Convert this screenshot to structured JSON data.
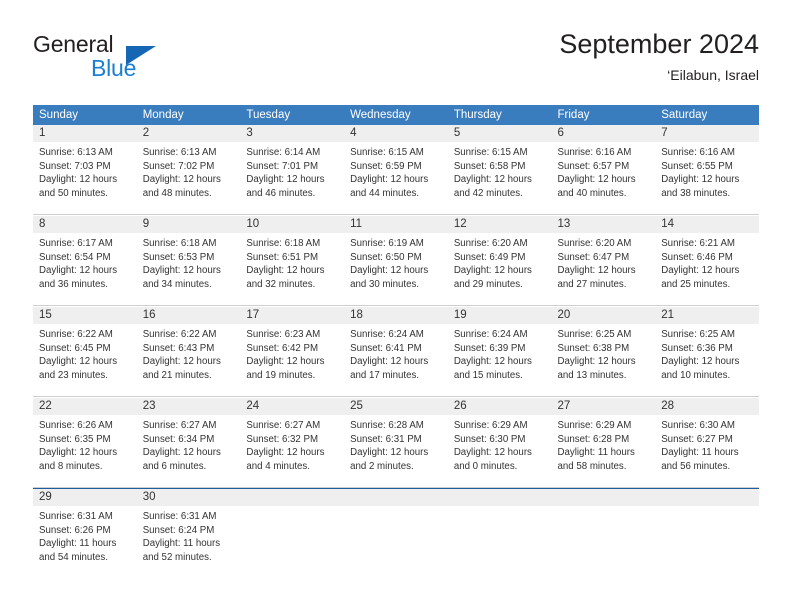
{
  "brand": {
    "name_part1": "General",
    "name_part2": "Blue",
    "triangle_color": "#1567b3",
    "blue_text_color": "#1a7fd4"
  },
  "header": {
    "title": "September 2024",
    "subtitle": "‘Eilabun, Israel"
  },
  "theme": {
    "header_bar_color": "#3a7dbf",
    "day_band_color": "#efefef",
    "cell_border_color": "#cfcfcf",
    "last_row_border_color": "#1f5fa0"
  },
  "weekdays": [
    "Sunday",
    "Monday",
    "Tuesday",
    "Wednesday",
    "Thursday",
    "Friday",
    "Saturday"
  ],
  "weeks": [
    [
      {
        "day": "1",
        "sunrise": "Sunrise: 6:13 AM",
        "sunset": "Sunset: 7:03 PM",
        "daylight": "Daylight: 12 hours and 50 minutes."
      },
      {
        "day": "2",
        "sunrise": "Sunrise: 6:13 AM",
        "sunset": "Sunset: 7:02 PM",
        "daylight": "Daylight: 12 hours and 48 minutes."
      },
      {
        "day": "3",
        "sunrise": "Sunrise: 6:14 AM",
        "sunset": "Sunset: 7:01 PM",
        "daylight": "Daylight: 12 hours and 46 minutes."
      },
      {
        "day": "4",
        "sunrise": "Sunrise: 6:15 AM",
        "sunset": "Sunset: 6:59 PM",
        "daylight": "Daylight: 12 hours and 44 minutes."
      },
      {
        "day": "5",
        "sunrise": "Sunrise: 6:15 AM",
        "sunset": "Sunset: 6:58 PM",
        "daylight": "Daylight: 12 hours and 42 minutes."
      },
      {
        "day": "6",
        "sunrise": "Sunrise: 6:16 AM",
        "sunset": "Sunset: 6:57 PM",
        "daylight": "Daylight: 12 hours and 40 minutes."
      },
      {
        "day": "7",
        "sunrise": "Sunrise: 6:16 AM",
        "sunset": "Sunset: 6:55 PM",
        "daylight": "Daylight: 12 hours and 38 minutes."
      }
    ],
    [
      {
        "day": "8",
        "sunrise": "Sunrise: 6:17 AM",
        "sunset": "Sunset: 6:54 PM",
        "daylight": "Daylight: 12 hours and 36 minutes."
      },
      {
        "day": "9",
        "sunrise": "Sunrise: 6:18 AM",
        "sunset": "Sunset: 6:53 PM",
        "daylight": "Daylight: 12 hours and 34 minutes."
      },
      {
        "day": "10",
        "sunrise": "Sunrise: 6:18 AM",
        "sunset": "Sunset: 6:51 PM",
        "daylight": "Daylight: 12 hours and 32 minutes."
      },
      {
        "day": "11",
        "sunrise": "Sunrise: 6:19 AM",
        "sunset": "Sunset: 6:50 PM",
        "daylight": "Daylight: 12 hours and 30 minutes."
      },
      {
        "day": "12",
        "sunrise": "Sunrise: 6:20 AM",
        "sunset": "Sunset: 6:49 PM",
        "daylight": "Daylight: 12 hours and 29 minutes."
      },
      {
        "day": "13",
        "sunrise": "Sunrise: 6:20 AM",
        "sunset": "Sunset: 6:47 PM",
        "daylight": "Daylight: 12 hours and 27 minutes."
      },
      {
        "day": "14",
        "sunrise": "Sunrise: 6:21 AM",
        "sunset": "Sunset: 6:46 PM",
        "daylight": "Daylight: 12 hours and 25 minutes."
      }
    ],
    [
      {
        "day": "15",
        "sunrise": "Sunrise: 6:22 AM",
        "sunset": "Sunset: 6:45 PM",
        "daylight": "Daylight: 12 hours and 23 minutes."
      },
      {
        "day": "16",
        "sunrise": "Sunrise: 6:22 AM",
        "sunset": "Sunset: 6:43 PM",
        "daylight": "Daylight: 12 hours and 21 minutes."
      },
      {
        "day": "17",
        "sunrise": "Sunrise: 6:23 AM",
        "sunset": "Sunset: 6:42 PM",
        "daylight": "Daylight: 12 hours and 19 minutes."
      },
      {
        "day": "18",
        "sunrise": "Sunrise: 6:24 AM",
        "sunset": "Sunset: 6:41 PM",
        "daylight": "Daylight: 12 hours and 17 minutes."
      },
      {
        "day": "19",
        "sunrise": "Sunrise: 6:24 AM",
        "sunset": "Sunset: 6:39 PM",
        "daylight": "Daylight: 12 hours and 15 minutes."
      },
      {
        "day": "20",
        "sunrise": "Sunrise: 6:25 AM",
        "sunset": "Sunset: 6:38 PM",
        "daylight": "Daylight: 12 hours and 13 minutes."
      },
      {
        "day": "21",
        "sunrise": "Sunrise: 6:25 AM",
        "sunset": "Sunset: 6:36 PM",
        "daylight": "Daylight: 12 hours and 10 minutes."
      }
    ],
    [
      {
        "day": "22",
        "sunrise": "Sunrise: 6:26 AM",
        "sunset": "Sunset: 6:35 PM",
        "daylight": "Daylight: 12 hours and 8 minutes."
      },
      {
        "day": "23",
        "sunrise": "Sunrise: 6:27 AM",
        "sunset": "Sunset: 6:34 PM",
        "daylight": "Daylight: 12 hours and 6 minutes."
      },
      {
        "day": "24",
        "sunrise": "Sunrise: 6:27 AM",
        "sunset": "Sunset: 6:32 PM",
        "daylight": "Daylight: 12 hours and 4 minutes."
      },
      {
        "day": "25",
        "sunrise": "Sunrise: 6:28 AM",
        "sunset": "Sunset: 6:31 PM",
        "daylight": "Daylight: 12 hours and 2 minutes."
      },
      {
        "day": "26",
        "sunrise": "Sunrise: 6:29 AM",
        "sunset": "Sunset: 6:30 PM",
        "daylight": "Daylight: 12 hours and 0 minutes."
      },
      {
        "day": "27",
        "sunrise": "Sunrise: 6:29 AM",
        "sunset": "Sunset: 6:28 PM",
        "daylight": "Daylight: 11 hours and 58 minutes."
      },
      {
        "day": "28",
        "sunrise": "Sunrise: 6:30 AM",
        "sunset": "Sunset: 6:27 PM",
        "daylight": "Daylight: 11 hours and 56 minutes."
      }
    ],
    [
      {
        "day": "29",
        "sunrise": "Sunrise: 6:31 AM",
        "sunset": "Sunset: 6:26 PM",
        "daylight": "Daylight: 11 hours and 54 minutes."
      },
      {
        "day": "30",
        "sunrise": "Sunrise: 6:31 AM",
        "sunset": "Sunset: 6:24 PM",
        "daylight": "Daylight: 11 hours and 52 minutes."
      },
      {
        "day": "",
        "sunrise": "",
        "sunset": "",
        "daylight": ""
      },
      {
        "day": "",
        "sunrise": "",
        "sunset": "",
        "daylight": ""
      },
      {
        "day": "",
        "sunrise": "",
        "sunset": "",
        "daylight": ""
      },
      {
        "day": "",
        "sunrise": "",
        "sunset": "",
        "daylight": ""
      },
      {
        "day": "",
        "sunrise": "",
        "sunset": "",
        "daylight": ""
      }
    ]
  ]
}
